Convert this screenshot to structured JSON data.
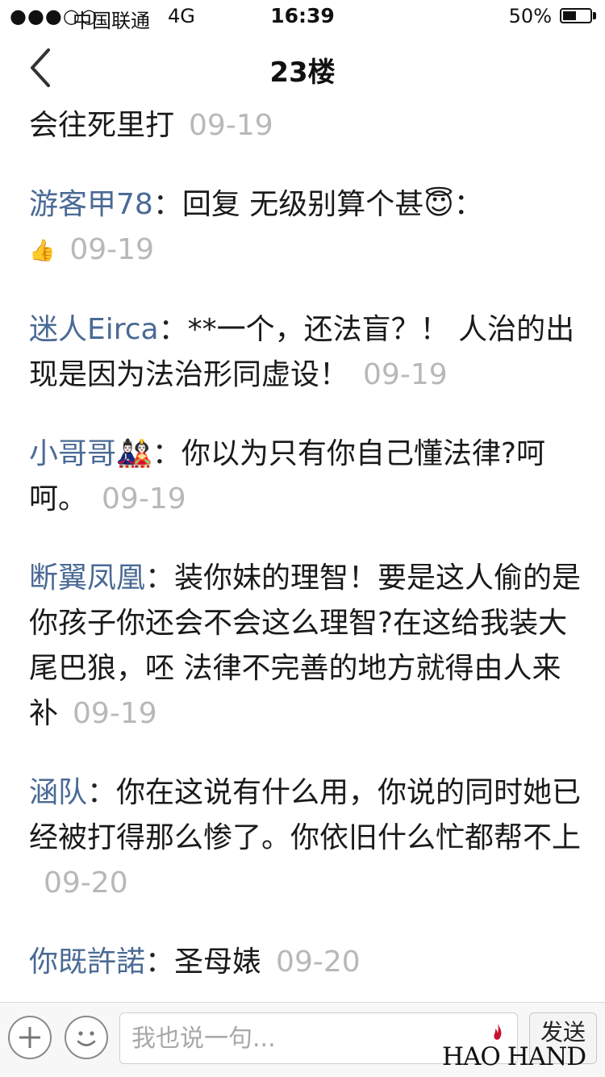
{
  "status_bar": {
    "signal": "●●●○○",
    "carrier": "中国联通",
    "network": "4G",
    "time": "16:39",
    "battery": "50%",
    "battery_level": 0.5
  },
  "nav": {
    "title": "23楼",
    "back_icon": "chevron-left-icon"
  },
  "comments": [
    {
      "user": "",
      "text": "会往死里打",
      "date": "09-19"
    },
    {
      "user": "游客甲78",
      "text": "回复 无级别算个甚😇：",
      "extra": "👍",
      "date": "09-19"
    },
    {
      "user": "迷人Eirca",
      "text": "**一个，还法盲？！ 人治的出现是因为法治形同虚设！",
      "date": "09-19"
    },
    {
      "user": "小哥哥🎎",
      "text": "你以为只有你自己懂法律?呵呵。",
      "date": "09-19"
    },
    {
      "user": "断翼凤凰",
      "text": "装你妹的理智！要是这人偷的是你孩子你还会不会这么理智?在这给我装大尾巴狼，呸 法律不完善的地方就得由人来补",
      "date": "09-19"
    },
    {
      "user": "涵队",
      "text": "你在这说有什么用，你说的同时她已经被打得那么惨了。你依旧什么忙都帮不上",
      "date": "09-20"
    },
    {
      "user": "你既許諾",
      "text": "圣母婊",
      "date": "09-20"
    }
  ],
  "bottom_bar": {
    "plus_icon": "plus-icon",
    "emoji_icon": "smiley-icon",
    "input_placeholder": "我也说一句...",
    "send_label": "发送"
  },
  "watermark": {
    "text": "HAO HAND"
  }
}
